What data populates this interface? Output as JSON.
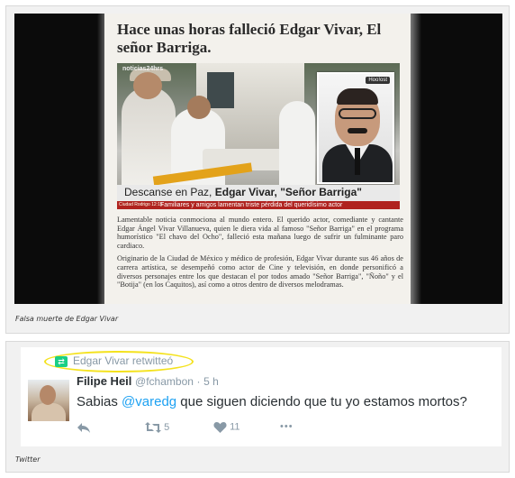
{
  "figure1": {
    "caption": "Falsa muerte de Edgar Vivar",
    "article": {
      "headline": "Hace unas horas falleció Edgar Vivar, El señor Barriga.",
      "channel_logo": "noticias24hrs",
      "inset_logo": "Hoo!ost",
      "banner_prefix": "Descanse en Paz, ",
      "banner_bold": "Edgar Vivar, \"Señor Barriga\"",
      "subbanner_tag": "Ciudad Rodrigo 12:15",
      "subbanner": "Familiares y amigos lamentan triste pérdida del queridísimo actor",
      "paragraph1": "Lamentable noticia conmociona al mundo entero. El querido actor, comediante y cantante Edgar Ángel Vivar Villanueva, quien le diera vida al famoso \"Señor Barriga\" en el programa humorístico \"El chavo del Ocho\", falleció esta mañana luego de sufrir un fulminante paro cardiaco.",
      "paragraph2": "Originario de la Ciudad de México y médico de profesión, Edgar Vivar durante sus 46 años de carrera artística, se desempeñó como actor de Cine y televisión, en donde personificó a diversos personajes entre los que destacan el por todos amado \"Señor Barriga\", \"Ñoño\" y el \"Botija\" (en los Caquitos), así como a otros dentro de diversos melodramas."
    }
  },
  "figure2": {
    "caption": "Twitter",
    "tweet": {
      "retweeted_by": "Edgar Vivar retwitteó",
      "display_name": "Filipe Heil",
      "handle": "@fchambon",
      "separator": "·",
      "time": "5 h",
      "text_before": "Sabias ",
      "mention": "@varedg",
      "text_after": " que siguen diciendo que tu yo estamos mortos?",
      "retweet_count": "5",
      "like_count": "11",
      "more": "•••"
    },
    "highlight_color": "#f4e21e",
    "mention_color": "#1da1f2",
    "retweet_icon_color": "#19cf86"
  }
}
